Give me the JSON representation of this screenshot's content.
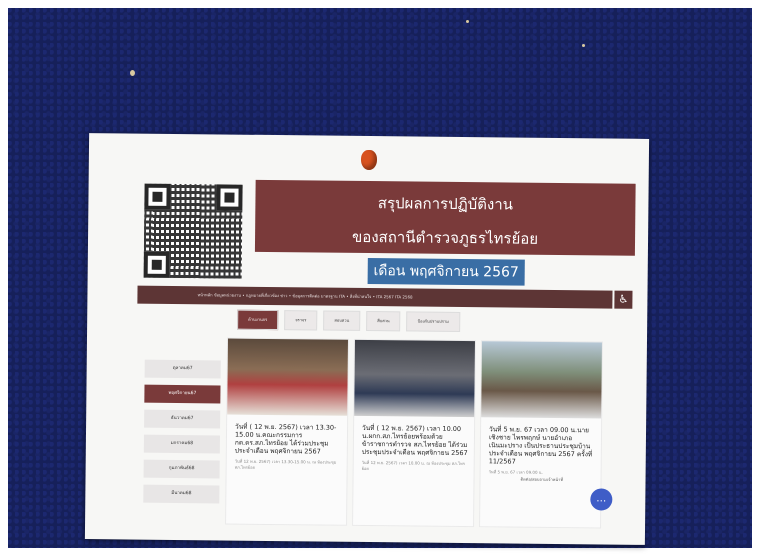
{
  "poster": {
    "title_line1": "สรุปผลการปฏิบัติงาน",
    "title_line2": "ของสถานีตำรวจภูธรไทรย้อย",
    "month": "เดือน พฤศจิกายน 2567"
  },
  "navbar": {
    "text": "หน้าหลัก  ข้อมูลหน่วยงาน  •  กฎหมายที่เกี่ยวข้อง  ข่าว  •  ข้อมูลการติดต่อ  มาตรฐาน ITA  •  สิ่งที่น่าสนใจ  •  ITA 2567  ITA 2568"
  },
  "tabs": [
    "ด้านงานจร",
    "จราจร",
    "สอบสวน",
    "สืบสวน",
    "ป้องกันปราบปราม"
  ],
  "sidebar": [
    "ตุลาคม67",
    "พฤศจิกายน67",
    "ธันวาคม67",
    "มกราคม68",
    "กุมภาพันธ์68",
    "มีนาคม68"
  ],
  "cards": [
    {
      "title": "วันที่ ( 12 พ.ย. 2567) เวลา 13.30-15.00 น.คณะกรรมการ กต.ตร.สภ.ไทรย้อย ได้ร่วมประชุมประจำเดือน พฤศจิกายน 2567",
      "meta": "วันที่ 12 พ.ย. 2567) เวลา 13.30-15.00 น. ณ ห้องประชุม สภ.ไทรย้อย"
    },
    {
      "title": "วันที่ ( 12 พ.ย. 2567) เวลา 10.00 น.ผกก.สภ.ไทรย้อยพร้อมด้วยข้าราชการตำรวจ สภ.ไทรย้อย ได้ร่วมประชุมประจำเดือน พฤศจิกายน 2567",
      "meta": "วันที่ 12 พ.ย. 2567) เวลา 10.00 น. ณ ห้องประชุม สภ.ไทรย้อย"
    },
    {
      "title": "วันที่ 5 พ.ย. 67 เวลา 09.00 น.นายเชิงชาย ไพรพฤกษ์ นายอำเภอเนินมะปราง เป็นประธานประชุมบ้านประจำเดือน พฤศจิกายน 2567 ครั้งที่ 11/2567",
      "meta": "วันที่ 5 พ.ย. 67 เวลา 09.00 น."
    }
  ],
  "chat_label": "ติดต่อ/สอบถามเจ้าหน้าที่",
  "colors": {
    "board": "#16205a",
    "banner": "#7a3a3a",
    "month": "#3a6ea5",
    "pin": "#d8521f"
  },
  "icons": [
    "accessibility-icon",
    "chat-icon",
    "qr-code"
  ]
}
